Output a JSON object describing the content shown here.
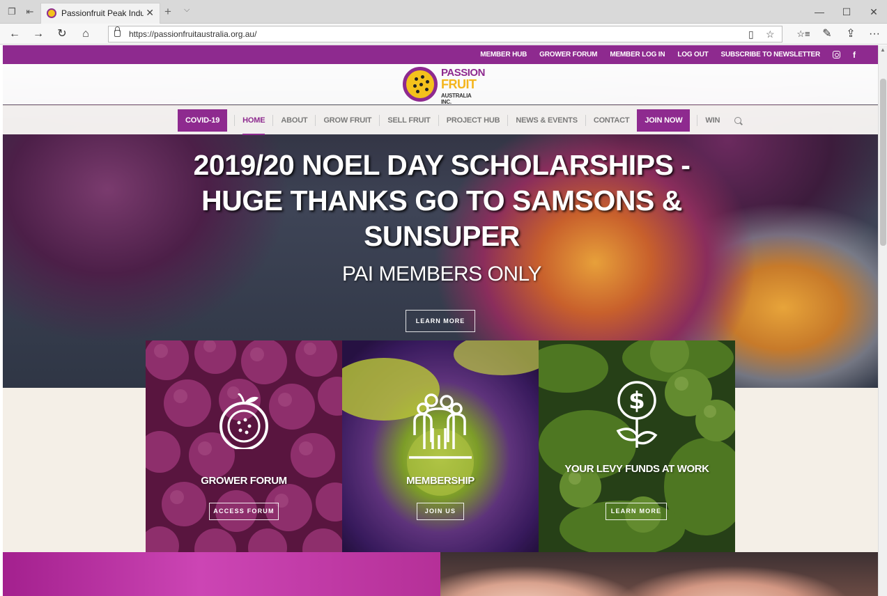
{
  "browser": {
    "tab_title": "Passionfruit Peak Indust",
    "url": "https://passionfruitaustralia.org.au/",
    "buttons": {
      "close_tab": "✕",
      "new_tab": "+",
      "tab_menu": "⌵",
      "back": "←",
      "forward": "→",
      "refresh": "↻",
      "home": "⌂",
      "reading_view": "▯",
      "favorite": "☆",
      "favorites_list": "☆≡",
      "pen": "✎",
      "share": "⇪",
      "more": "···",
      "minimize": "—",
      "maximize": "☐",
      "close_window": "✕"
    }
  },
  "site": {
    "colors": {
      "brand_purple": "#8e2a8f",
      "brand_yellow": "#f4c21c",
      "cream": "#f4efe7"
    },
    "top_links": [
      "MEMBER HUB",
      "GROWER FORUM",
      "MEMBER LOG IN",
      "LOG OUT",
      "SUBSCRIBE TO NEWSLETTER"
    ],
    "social_icons": [
      "instagram-icon",
      "facebook-icon"
    ],
    "facebook_glyph": "f",
    "logo": {
      "line1": "PASSION",
      "line2": "FRUIT",
      "line3": "AUSTRALIA INC."
    },
    "nav": {
      "items": [
        "COVID-19",
        "HOME",
        "ABOUT",
        "GROW FRUIT",
        "SELL FRUIT",
        "PROJECT HUB",
        "NEWS & EVENTS",
        "CONTACT",
        "JOIN NOW",
        "WIN"
      ],
      "active": "HOME"
    },
    "hero": {
      "title": "2019/20 NOEL DAY SCHOLARSHIPS - HUGE THANKS GO TO SAMSONS & SUNSUPER",
      "subtitle": "PAI MEMBERS ONLY",
      "button": "LEARN MORE"
    },
    "cards": [
      {
        "title": "GROWER FORUM",
        "button": "ACCESS FORUM",
        "icon": "passionfruit-icon"
      },
      {
        "title": "MEMBERSHIP",
        "button": "JOIN US",
        "icon": "people-group-icon"
      },
      {
        "title": "YOUR LEVY FUNDS AT WORK",
        "button": "LEARN MORE",
        "icon": "money-plant-icon"
      }
    ]
  }
}
